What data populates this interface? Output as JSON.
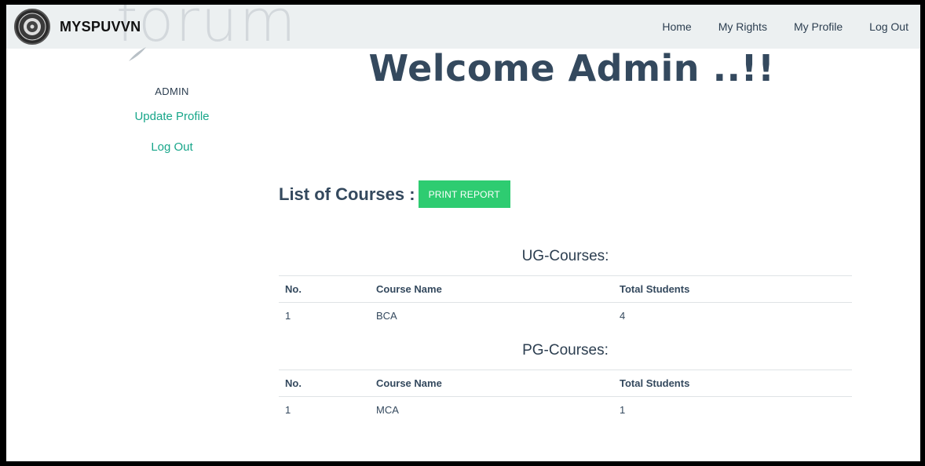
{
  "navbar": {
    "brand": "MYSPUVVN",
    "links": [
      "Home",
      "My Rights",
      "My Profile",
      "Log Out"
    ]
  },
  "sidebar": {
    "username": "ADMIN",
    "update_profile": "Update Profile",
    "logout": "Log Out"
  },
  "main": {
    "welcome": "Welcome Admin ..!!",
    "list_title": "List of Courses :",
    "print_button": "PRINT REPORT"
  },
  "tables": {
    "ug": {
      "title": "UG-Courses:",
      "headers": [
        "No.",
        "Course Name",
        "Total Students"
      ],
      "rows": [
        [
          "1",
          "BCA",
          "4"
        ]
      ]
    },
    "pg": {
      "title": "PG-Courses:",
      "headers": [
        "No.",
        "Course Name",
        "Total Students"
      ],
      "rows": [
        [
          "1",
          "MCA",
          "1"
        ]
      ]
    }
  },
  "colors": {
    "accent_green": "#2ecc71",
    "link_teal": "#18a68a",
    "heading": "#34495e",
    "navbar_bg": "#ecf0f1"
  }
}
